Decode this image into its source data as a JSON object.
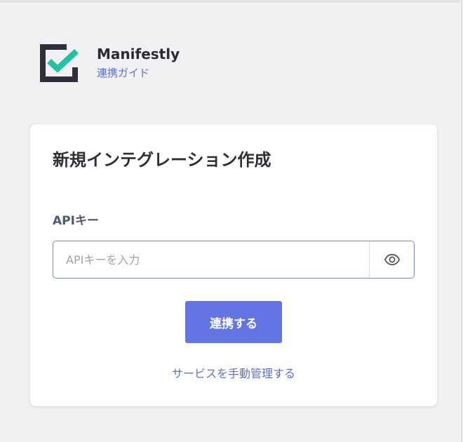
{
  "app": {
    "name": "Manifestly",
    "guide_link": "連携ガイド",
    "logo_icon": "manifestly-checkbox-logo-icon"
  },
  "card": {
    "title": "新規インテグレーション作成",
    "api_key_label": "APIキー",
    "api_key_placeholder": "APIキーを入力",
    "api_key_value": "",
    "toggle_icon": "eye-icon",
    "connect_button": "連携する",
    "manual_link": "サービスを手動管理する"
  },
  "colors": {
    "accent": "#6475e3",
    "link": "#5a6fd6",
    "logo_dark": "#2e2f3a",
    "logo_check": "#21c3a3"
  }
}
